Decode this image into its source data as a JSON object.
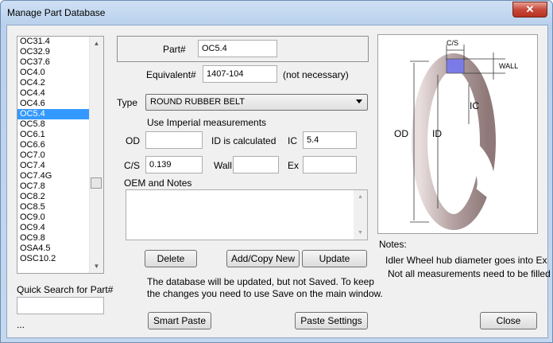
{
  "window": {
    "title": "Manage Part Database",
    "close_glyph": "✕"
  },
  "parts_list": {
    "items": [
      "OC31.4",
      "OC32.9",
      "OC37.6",
      "OC4.0",
      "OC4.2",
      "OC4.4",
      "OC4.6",
      "OC5.4",
      "OC5.8",
      "OC6.1",
      "OC6.6",
      "OC7.0",
      "OC7.4",
      "OC7.4G",
      "OC7.8",
      "OC8.2",
      "OC8.5",
      "OC9.0",
      "OC9.4",
      "OC9.8",
      "OSA4.5",
      "OSC10.2"
    ],
    "selected": "OC5.4"
  },
  "quick_search": {
    "label": "Quick Search for Part#",
    "value": "",
    "ellipsis": "..."
  },
  "part": {
    "label": "Part#",
    "value": "OC5.4"
  },
  "equivalent": {
    "label": "Equivalent#",
    "value": "1407-104",
    "hint": "(not necessary)"
  },
  "type": {
    "label": "Type",
    "value": "ROUND RUBBER BELT"
  },
  "measurements": {
    "units_label": "Use Imperial measurements",
    "od_label": "OD",
    "od_value": "",
    "id_note": "ID is calculated",
    "ic_label": "IC",
    "ic_value": "5.4",
    "cs_label": "C/S",
    "cs_value": "0.139",
    "wall_label": "Wall",
    "wall_value": "",
    "ex_label": "Ex",
    "ex_value": ""
  },
  "notes_field": {
    "label": "OEM and Notes",
    "value": ""
  },
  "buttons": {
    "delete": "Delete",
    "add_copy": "Add/Copy New",
    "update": "Update",
    "smart_paste": "Smart Paste",
    "paste_settings": "Paste Settings",
    "close": "Close"
  },
  "info_text": {
    "line1": "The database will be updated, but not Saved. To keep",
    "line2": "the changes you need to use Save on the main window."
  },
  "diagram": {
    "cs": "C/S",
    "wall": "WALL",
    "ic": "IC",
    "od": "OD",
    "id": "ID"
  },
  "notes": {
    "title": "Notes:",
    "line1": "Idler Wheel hub diameter goes into Ex",
    "line2": "Not all measurements need to be filled"
  },
  "colors": {
    "selection": "#3399ff",
    "ring": "#b7a3a3",
    "cross_section": "#7b7be8"
  }
}
